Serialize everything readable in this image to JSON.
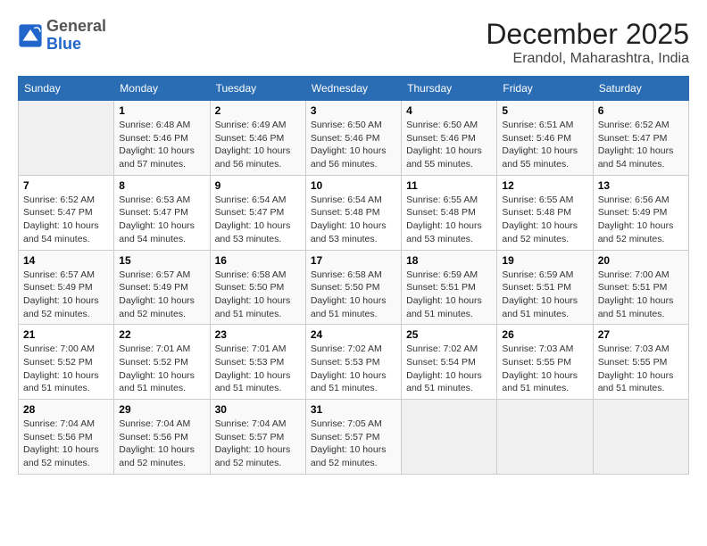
{
  "header": {
    "logo_general": "General",
    "logo_blue": "Blue",
    "month_year": "December 2025",
    "location": "Erandol, Maharashtra, India"
  },
  "weekdays": [
    "Sunday",
    "Monday",
    "Tuesday",
    "Wednesday",
    "Thursday",
    "Friday",
    "Saturday"
  ],
  "weeks": [
    [
      {
        "day": "",
        "info": ""
      },
      {
        "day": "1",
        "info": "Sunrise: 6:48 AM\nSunset: 5:46 PM\nDaylight: 10 hours\nand 57 minutes."
      },
      {
        "day": "2",
        "info": "Sunrise: 6:49 AM\nSunset: 5:46 PM\nDaylight: 10 hours\nand 56 minutes."
      },
      {
        "day": "3",
        "info": "Sunrise: 6:50 AM\nSunset: 5:46 PM\nDaylight: 10 hours\nand 56 minutes."
      },
      {
        "day": "4",
        "info": "Sunrise: 6:50 AM\nSunset: 5:46 PM\nDaylight: 10 hours\nand 55 minutes."
      },
      {
        "day": "5",
        "info": "Sunrise: 6:51 AM\nSunset: 5:46 PM\nDaylight: 10 hours\nand 55 minutes."
      },
      {
        "day": "6",
        "info": "Sunrise: 6:52 AM\nSunset: 5:47 PM\nDaylight: 10 hours\nand 54 minutes."
      }
    ],
    [
      {
        "day": "7",
        "info": "Sunrise: 6:52 AM\nSunset: 5:47 PM\nDaylight: 10 hours\nand 54 minutes."
      },
      {
        "day": "8",
        "info": "Sunrise: 6:53 AM\nSunset: 5:47 PM\nDaylight: 10 hours\nand 54 minutes."
      },
      {
        "day": "9",
        "info": "Sunrise: 6:54 AM\nSunset: 5:47 PM\nDaylight: 10 hours\nand 53 minutes."
      },
      {
        "day": "10",
        "info": "Sunrise: 6:54 AM\nSunset: 5:48 PM\nDaylight: 10 hours\nand 53 minutes."
      },
      {
        "day": "11",
        "info": "Sunrise: 6:55 AM\nSunset: 5:48 PM\nDaylight: 10 hours\nand 53 minutes."
      },
      {
        "day": "12",
        "info": "Sunrise: 6:55 AM\nSunset: 5:48 PM\nDaylight: 10 hours\nand 52 minutes."
      },
      {
        "day": "13",
        "info": "Sunrise: 6:56 AM\nSunset: 5:49 PM\nDaylight: 10 hours\nand 52 minutes."
      }
    ],
    [
      {
        "day": "14",
        "info": "Sunrise: 6:57 AM\nSunset: 5:49 PM\nDaylight: 10 hours\nand 52 minutes."
      },
      {
        "day": "15",
        "info": "Sunrise: 6:57 AM\nSunset: 5:49 PM\nDaylight: 10 hours\nand 52 minutes."
      },
      {
        "day": "16",
        "info": "Sunrise: 6:58 AM\nSunset: 5:50 PM\nDaylight: 10 hours\nand 51 minutes."
      },
      {
        "day": "17",
        "info": "Sunrise: 6:58 AM\nSunset: 5:50 PM\nDaylight: 10 hours\nand 51 minutes."
      },
      {
        "day": "18",
        "info": "Sunrise: 6:59 AM\nSunset: 5:51 PM\nDaylight: 10 hours\nand 51 minutes."
      },
      {
        "day": "19",
        "info": "Sunrise: 6:59 AM\nSunset: 5:51 PM\nDaylight: 10 hours\nand 51 minutes."
      },
      {
        "day": "20",
        "info": "Sunrise: 7:00 AM\nSunset: 5:51 PM\nDaylight: 10 hours\nand 51 minutes."
      }
    ],
    [
      {
        "day": "21",
        "info": "Sunrise: 7:00 AM\nSunset: 5:52 PM\nDaylight: 10 hours\nand 51 minutes."
      },
      {
        "day": "22",
        "info": "Sunrise: 7:01 AM\nSunset: 5:52 PM\nDaylight: 10 hours\nand 51 minutes."
      },
      {
        "day": "23",
        "info": "Sunrise: 7:01 AM\nSunset: 5:53 PM\nDaylight: 10 hours\nand 51 minutes."
      },
      {
        "day": "24",
        "info": "Sunrise: 7:02 AM\nSunset: 5:53 PM\nDaylight: 10 hours\nand 51 minutes."
      },
      {
        "day": "25",
        "info": "Sunrise: 7:02 AM\nSunset: 5:54 PM\nDaylight: 10 hours\nand 51 minutes."
      },
      {
        "day": "26",
        "info": "Sunrise: 7:03 AM\nSunset: 5:55 PM\nDaylight: 10 hours\nand 51 minutes."
      },
      {
        "day": "27",
        "info": "Sunrise: 7:03 AM\nSunset: 5:55 PM\nDaylight: 10 hours\nand 51 minutes."
      }
    ],
    [
      {
        "day": "28",
        "info": "Sunrise: 7:04 AM\nSunset: 5:56 PM\nDaylight: 10 hours\nand 52 minutes."
      },
      {
        "day": "29",
        "info": "Sunrise: 7:04 AM\nSunset: 5:56 PM\nDaylight: 10 hours\nand 52 minutes."
      },
      {
        "day": "30",
        "info": "Sunrise: 7:04 AM\nSunset: 5:57 PM\nDaylight: 10 hours\nand 52 minutes."
      },
      {
        "day": "31",
        "info": "Sunrise: 7:05 AM\nSunset: 5:57 PM\nDaylight: 10 hours\nand 52 minutes."
      },
      {
        "day": "",
        "info": ""
      },
      {
        "day": "",
        "info": ""
      },
      {
        "day": "",
        "info": ""
      }
    ]
  ]
}
